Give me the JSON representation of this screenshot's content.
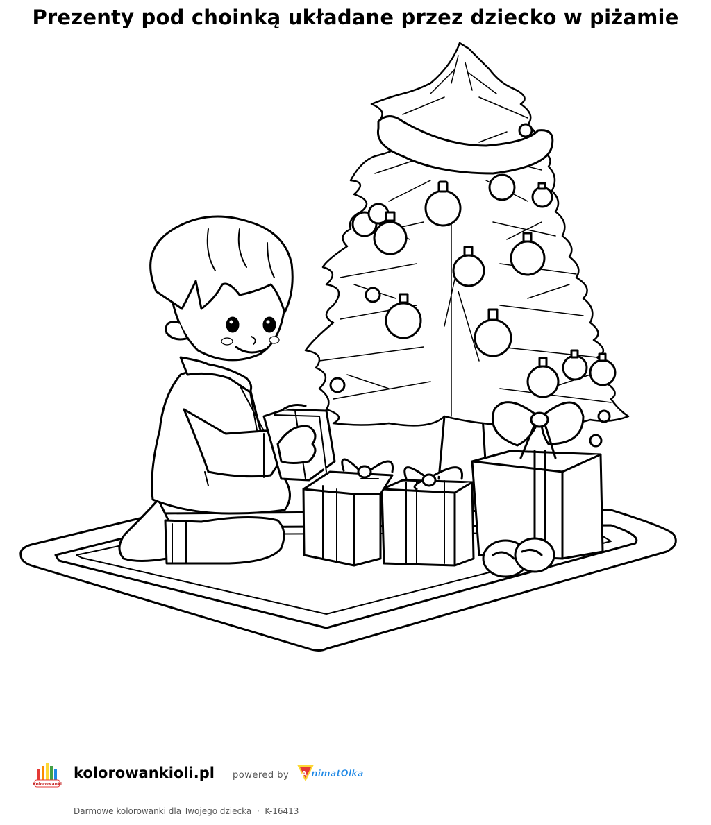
{
  "page": {
    "title": "Prezenty pod choinką układane przez dziecko w piżamie"
  },
  "illustration": {
    "icon": "coloring-page-illustration"
  },
  "footer": {
    "site_name": "kolorowankioli.pl",
    "powered_by": "powered by",
    "partner_logo_text": "AnimatOlka",
    "site_logo_text": "KolorowankiOli",
    "tagline": "Darmowe kolorowanki dla Twojego dziecka",
    "separator": "·",
    "code": "K-16413"
  },
  "colors": {
    "text": "#000000",
    "muted": "#555555",
    "partner_blue": "#1e88e5",
    "partner_red": "#e53935"
  }
}
